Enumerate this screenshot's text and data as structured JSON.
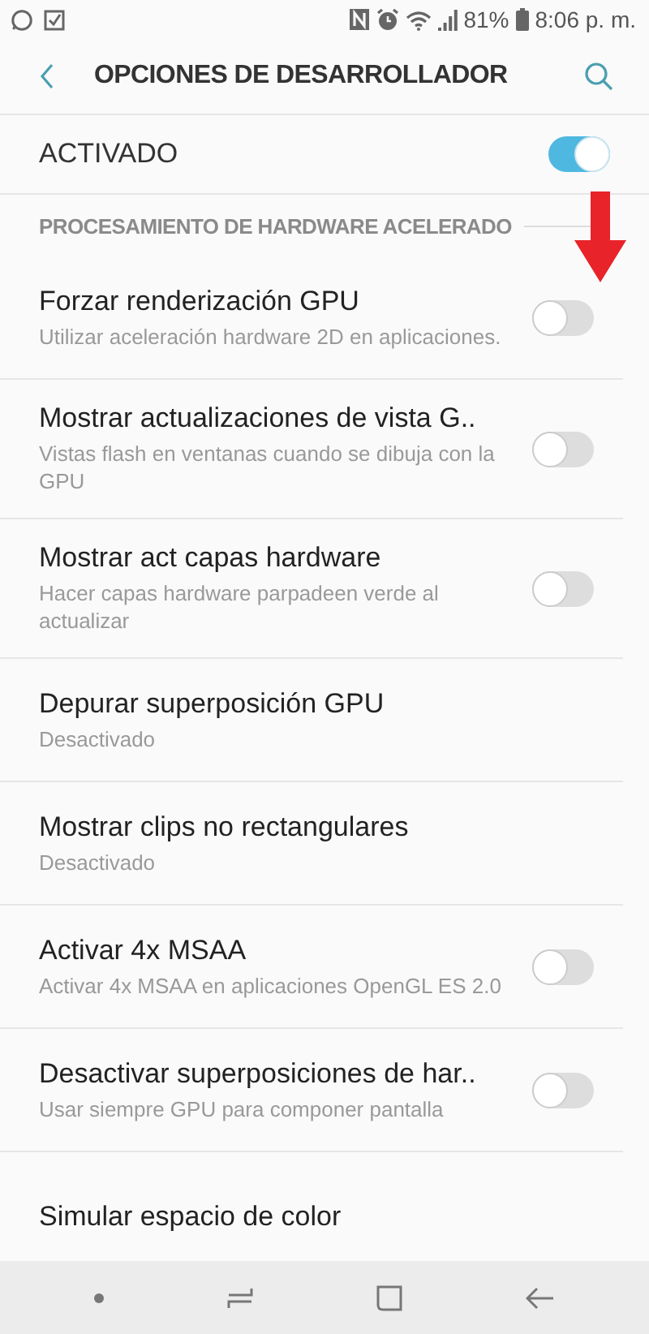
{
  "status_bar": {
    "battery": "81%",
    "time": "8:06 p. m."
  },
  "header": {
    "title": "OPCIONES DE DESARROLLADOR"
  },
  "master": {
    "label": "ACTIVADO",
    "on": true
  },
  "section": {
    "title": "PROCESAMIENTO DE HARDWARE ACELERADO"
  },
  "settings": [
    {
      "kind": "toggle",
      "title": "Forzar renderización GPU",
      "subtitle": "Utilizar aceleración hardware 2D en aplicaciones.",
      "on": false
    },
    {
      "kind": "toggle",
      "title": "Mostrar actualizaciones de vista G..",
      "subtitle": "Vistas flash en ventanas cuando se dibuja con la GPU",
      "on": false
    },
    {
      "kind": "toggle",
      "title": "Mostrar act capas hardware",
      "subtitle": "Hacer capas hardware parpadeen verde al actualizar",
      "on": false
    },
    {
      "kind": "choice",
      "title": "Depurar superposición GPU",
      "subtitle": "Desactivado"
    },
    {
      "kind": "choice",
      "title": "Mostrar clips no rectangulares",
      "subtitle": "Desactivado"
    },
    {
      "kind": "toggle",
      "title": "Activar 4x MSAA",
      "subtitle": "Activar 4x MSAA en aplicaciones OpenGL ES 2.0",
      "on": false
    },
    {
      "kind": "toggle",
      "title": "Desactivar superposiciones de har..",
      "subtitle": "Usar siempre GPU para componer pantalla",
      "on": false
    },
    {
      "kind": "choice",
      "title": "Simular espacio de color"
    }
  ]
}
